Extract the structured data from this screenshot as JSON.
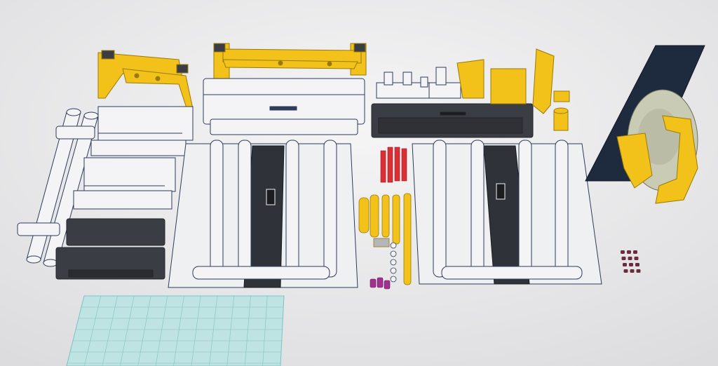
{
  "app": {
    "view": "3d-workplane",
    "mode": "design-editor"
  },
  "colors": {
    "background": "#e9e9ea",
    "yellow": "#f2c21b",
    "yellow_dark": "#9a7a06",
    "white_part": "#f4f4f6",
    "outline": "#2d3c5a",
    "dark_part": "#3b3d44",
    "navy_plate": "#1e2a3e",
    "red": "#dc2f35",
    "magenta": "#a3308f",
    "grid": "#bfe2e2",
    "grid_line": "#7fc4c4"
  },
  "objects": [
    {
      "id": "yellow-bracket-left"
    },
    {
      "id": "yellow-frame-top"
    },
    {
      "id": "white-drawers"
    },
    {
      "id": "dark-trays"
    },
    {
      "id": "long-white-box"
    },
    {
      "id": "dark-long-box"
    },
    {
      "id": "rail-plate-left"
    },
    {
      "id": "rail-plate-right"
    },
    {
      "id": "small-clips"
    },
    {
      "id": "yellow-parts-cluster"
    },
    {
      "id": "red-sticks"
    },
    {
      "id": "yellow-rods"
    },
    {
      "id": "navy-plate"
    },
    {
      "id": "head-model"
    },
    {
      "id": "tiny-screws"
    },
    {
      "id": "workplane-grid"
    }
  ]
}
